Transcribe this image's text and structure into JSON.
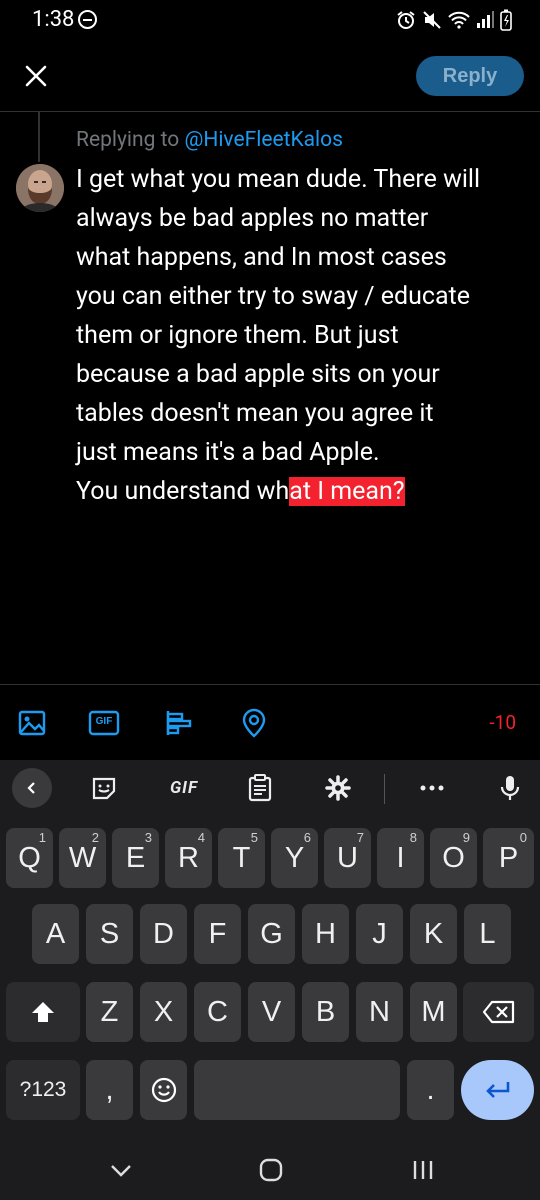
{
  "status_bar": {
    "time": "1:38"
  },
  "header": {
    "reply_label": "Reply"
  },
  "compose": {
    "replying_prefix": "Replying to",
    "replying_handle": "@HiveFleetKalos",
    "lines": [
      "I get what you mean dude. There will",
      "always be bad apples no matter",
      "what happens, and In most cases",
      "you can either try to sway / educate",
      "them or ignore them. But just",
      "because a bad apple sits on your",
      "tables doesn't mean you agree it",
      "just means it's a bad Apple."
    ],
    "last_line_normal": "You understand wh",
    "last_line_overflow": "at I mean?"
  },
  "toolbar": {
    "char_count": "-10",
    "gif_label": "GIF"
  },
  "keyboard": {
    "gif_label": "GIF",
    "row1": [
      {
        "key": "Q",
        "hint": "1"
      },
      {
        "key": "W",
        "hint": "2"
      },
      {
        "key": "E",
        "hint": "3"
      },
      {
        "key": "R",
        "hint": "4"
      },
      {
        "key": "T",
        "hint": "5"
      },
      {
        "key": "Y",
        "hint": "6"
      },
      {
        "key": "U",
        "hint": "7"
      },
      {
        "key": "I",
        "hint": "8"
      },
      {
        "key": "O",
        "hint": "9"
      },
      {
        "key": "P",
        "hint": "0"
      }
    ],
    "row2": [
      "A",
      "S",
      "D",
      "F",
      "G",
      "H",
      "J",
      "K",
      "L"
    ],
    "row3": [
      "Z",
      "X",
      "C",
      "V",
      "B",
      "N",
      "M"
    ],
    "symbols_label": "?123",
    "comma": ",",
    "period": "."
  },
  "colors": {
    "accent": "#1d9bf0",
    "overflow": "#f4212e",
    "reply_button": "#1a5c8c",
    "enter_key": "#a8c7fa"
  }
}
